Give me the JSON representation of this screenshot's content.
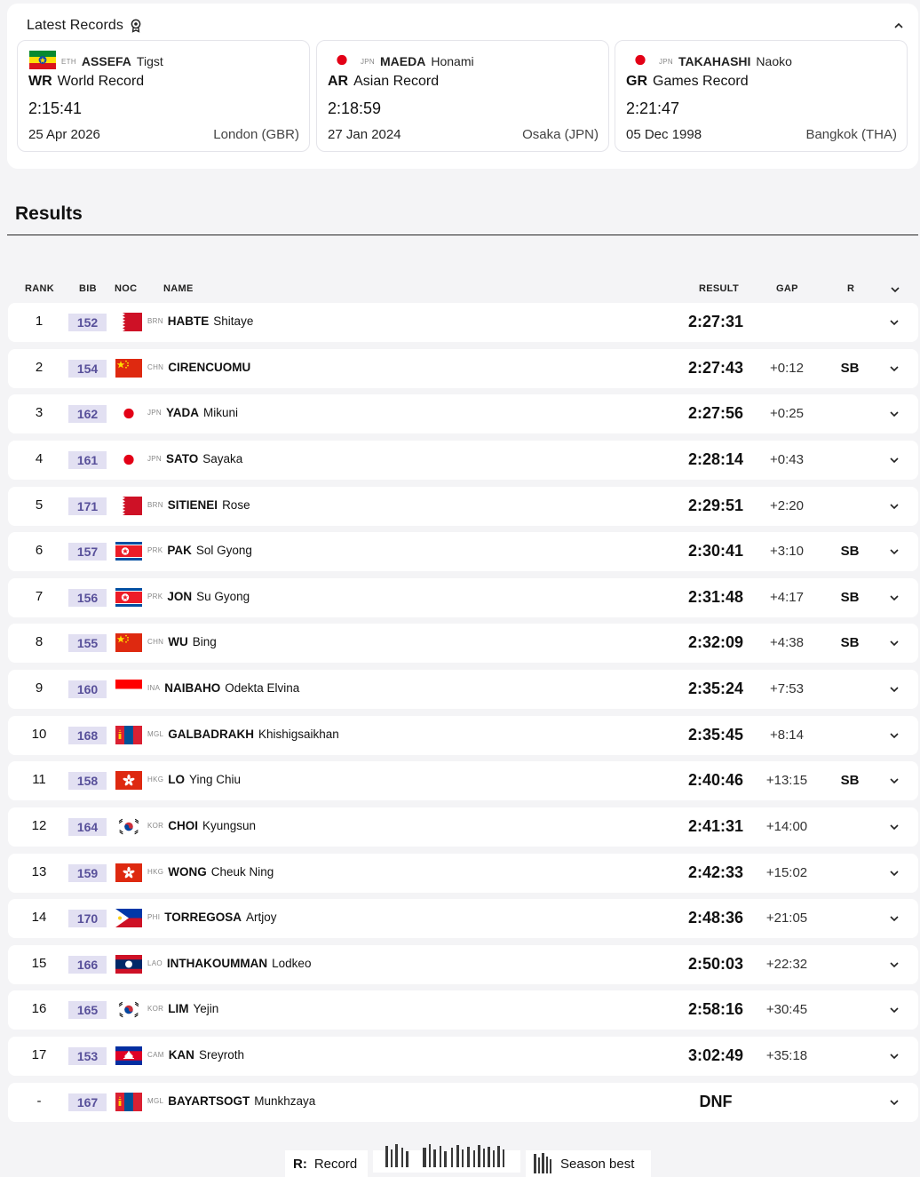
{
  "records": {
    "title": "Latest Records",
    "icon": "award-ribbon-icon",
    "toggle_icon": "chevron-up-icon",
    "cards": [
      {
        "noc": "ETH",
        "surname": "ASSEFA",
        "given": "Tigst",
        "type_abbr": "WR",
        "type": "World Record",
        "result": "2:15:41",
        "date": "25 Apr 2026",
        "venue": "London (GBR)",
        "flag": "ETH"
      },
      {
        "noc": "JPN",
        "surname": "MAEDA",
        "given": "Honami",
        "type_abbr": "AR",
        "type": "Asian Record",
        "result": "2:18:59",
        "date": "27 Jan 2024",
        "venue": "Osaka (JPN)",
        "flag": "JPN"
      },
      {
        "noc": "JPN",
        "surname": "TAKAHASHI",
        "given": "Naoko",
        "type_abbr": "GR",
        "type": "Games Record",
        "result": "2:21:47",
        "date": "05 Dec 1998",
        "venue": "Bangkok (THA)",
        "flag": "JPN"
      }
    ]
  },
  "results": {
    "title": "Results",
    "columns": {
      "rank": "RANK",
      "bib": "BIB",
      "noc": "NOC",
      "name": "NAME",
      "result": "RESULT",
      "gap": "GAP",
      "record": "R"
    },
    "rows": [
      {
        "rank": "1",
        "bib": "152",
        "noc": "BRN",
        "surname": "HABTE",
        "given": "Shitaye",
        "result": "2:27:31",
        "gap": "",
        "record": ""
      },
      {
        "rank": "2",
        "bib": "154",
        "noc": "CHN",
        "surname": "CIRENCUOMU",
        "given": "",
        "result": "2:27:43",
        "gap": "+0:12",
        "record": "SB"
      },
      {
        "rank": "3",
        "bib": "162",
        "noc": "JPN",
        "surname": "YADA",
        "given": "Mikuni",
        "result": "2:27:56",
        "gap": "+0:25",
        "record": ""
      },
      {
        "rank": "4",
        "bib": "161",
        "noc": "JPN",
        "surname": "SATO",
        "given": "Sayaka",
        "result": "2:28:14",
        "gap": "+0:43",
        "record": ""
      },
      {
        "rank": "5",
        "bib": "171",
        "noc": "BRN",
        "surname": "SITIENEI",
        "given": "Rose",
        "result": "2:29:51",
        "gap": "+2:20",
        "record": ""
      },
      {
        "rank": "6",
        "bib": "157",
        "noc": "PRK",
        "surname": "PAK",
        "given": "Sol Gyong",
        "result": "2:30:41",
        "gap": "+3:10",
        "record": "SB"
      },
      {
        "rank": "7",
        "bib": "156",
        "noc": "PRK",
        "surname": "JON",
        "given": "Su Gyong",
        "result": "2:31:48",
        "gap": "+4:17",
        "record": "SB"
      },
      {
        "rank": "8",
        "bib": "155",
        "noc": "CHN",
        "surname": "WU",
        "given": "Bing",
        "result": "2:32:09",
        "gap": "+4:38",
        "record": "SB"
      },
      {
        "rank": "9",
        "bib": "160",
        "noc": "INA",
        "surname": "NAIBAHO",
        "given": "Odekta Elvina",
        "result": "2:35:24",
        "gap": "+7:53",
        "record": ""
      },
      {
        "rank": "10",
        "bib": "168",
        "noc": "MGL",
        "surname": "GALBADRAKH",
        "given": "Khishigsaikhan",
        "result": "2:35:45",
        "gap": "+8:14",
        "record": ""
      },
      {
        "rank": "11",
        "bib": "158",
        "noc": "HKG",
        "surname": "LO",
        "given": "Ying Chiu",
        "result": "2:40:46",
        "gap": "+13:15",
        "record": "SB"
      },
      {
        "rank": "12",
        "bib": "164",
        "noc": "KOR",
        "surname": "CHOI",
        "given": "Kyungsun",
        "result": "2:41:31",
        "gap": "+14:00",
        "record": ""
      },
      {
        "rank": "13",
        "bib": "159",
        "noc": "HKG",
        "surname": "WONG",
        "given": "Cheuk Ning",
        "result": "2:42:33",
        "gap": "+15:02",
        "record": ""
      },
      {
        "rank": "14",
        "bib": "170",
        "noc": "PHI",
        "surname": "TORREGOSA",
        "given": "Artjoy",
        "result": "2:48:36",
        "gap": "+21:05",
        "record": ""
      },
      {
        "rank": "15",
        "bib": "166",
        "noc": "LAO",
        "surname": "INTHAKOUMMAN",
        "given": "Lodkeo",
        "result": "2:50:03",
        "gap": "+22:32",
        "record": ""
      },
      {
        "rank": "16",
        "bib": "165",
        "noc": "KOR",
        "surname": "LIM",
        "given": "Yejin",
        "result": "2:58:16",
        "gap": "+30:45",
        "record": ""
      },
      {
        "rank": "17",
        "bib": "153",
        "noc": "CAM",
        "surname": "KAN",
        "given": "Sreyroth",
        "result": "3:02:49",
        "gap": "+35:18",
        "record": ""
      },
      {
        "rank": "-",
        "bib": "167",
        "noc": "MGL",
        "surname": "BAYARTSOGT",
        "given": "Munkhzaya",
        "result": "DNF",
        "gap": "",
        "record": ""
      }
    ]
  },
  "legend": {
    "record_key": "R:",
    "record_label": "Record",
    "sb_label": "Season best"
  },
  "colors": {
    "bib_bg": "#e2e0f2",
    "bib_text": "#58509a",
    "page_bg": "#f4f4f6"
  }
}
